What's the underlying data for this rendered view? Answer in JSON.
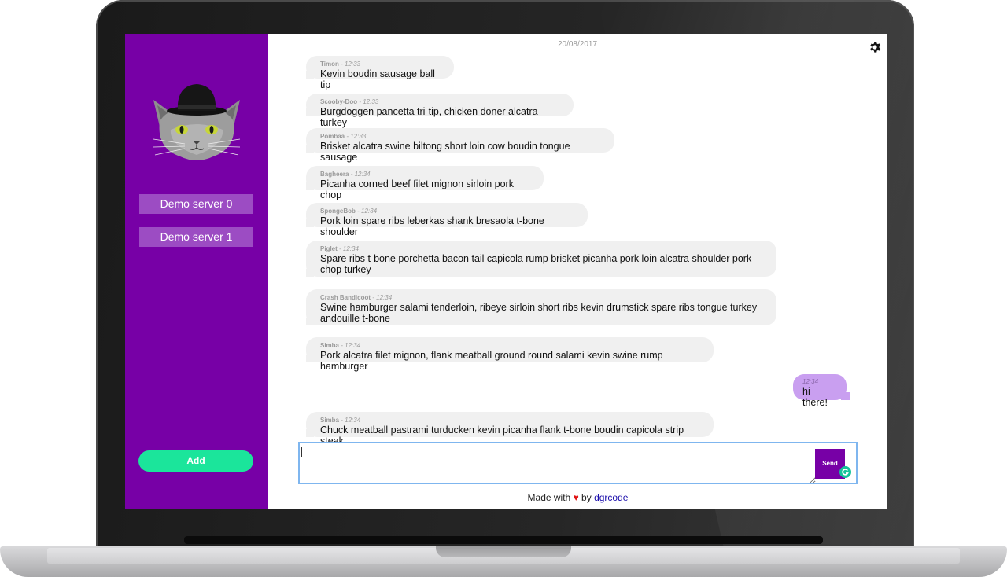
{
  "sidebar": {
    "servers": [
      {
        "label": "Demo server 0"
      },
      {
        "label": "Demo server 1"
      }
    ],
    "add_label": "Add",
    "avatar": "cat-with-bowler-hat"
  },
  "chat": {
    "date": "20/08/2017",
    "messages": [
      {
        "author": "Timon",
        "time": "12:33",
        "text": "Kevin boudin sausage ball tip"
      },
      {
        "author": "Scooby-Doo",
        "time": "12:33",
        "text": "Burgdoggen pancetta tri-tip, chicken doner alcatra turkey"
      },
      {
        "author": "Pombaa",
        "time": "12:33",
        "text": "Brisket alcatra swine biltong short loin cow boudin tongue sausage"
      },
      {
        "author": "Bagheera",
        "time": "12:34",
        "text": "Picanha corned beef filet mignon sirloin pork chop"
      },
      {
        "author": "SpongeBob",
        "time": "12:34",
        "text": "Pork loin spare ribs leberkas shank bresaola t-bone shoulder"
      },
      {
        "author": "Piglet",
        "time": "12:34",
        "text": "Spare ribs t-bone porchetta bacon tail capicola rump brisket picanha pork loin alcatra shoulder pork chop turkey"
      },
      {
        "author": "Crash Bandicoot",
        "time": "12:34",
        "text": "Swine hamburger salami tenderloin, ribeye sirloin short ribs kevin drumstick spare ribs tongue turkey andouille t-bone"
      },
      {
        "author": "Simba",
        "time": "12:34",
        "text": "Pork alcatra filet mignon, flank meatball ground round salami kevin swine rump hamburger"
      },
      {
        "author": "Simba",
        "time": "12:34",
        "text": "Chuck meatball pastrami turducken kevin picanha flank t-bone boudin capicola strip steak"
      }
    ],
    "own_message": {
      "time": "12:34",
      "text": "hi there!"
    },
    "settings_icon": "gear-icon"
  },
  "composer": {
    "value": "",
    "send_label": "Send"
  },
  "footer": {
    "made_with": "Made with",
    "by": "by",
    "author": "dgrcode"
  },
  "colors": {
    "sidebar": "#7700a6",
    "server_button": "#9c4cc3",
    "add_button": "#1be59b",
    "own_bubble": "#c99ff0",
    "other_bubble": "#f0f0f0",
    "send_button": "#7700a6",
    "input_border": "#7fb6ef"
  }
}
